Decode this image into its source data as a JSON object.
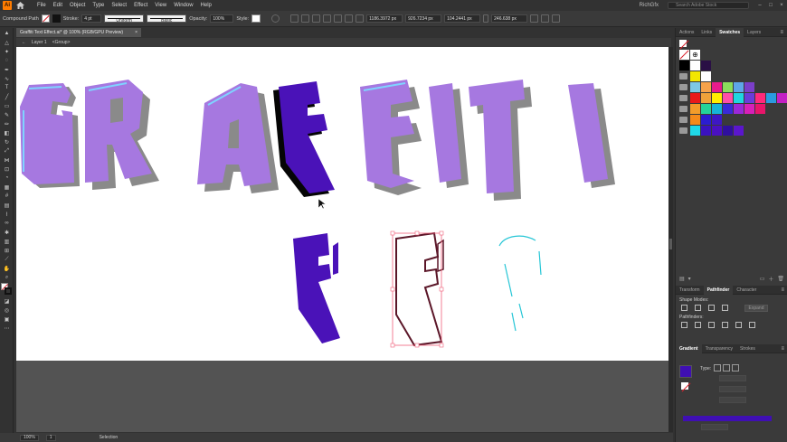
{
  "menubar": {
    "logo": "Ai",
    "items": [
      "File",
      "Edit",
      "Object",
      "Type",
      "Select",
      "Effect",
      "View",
      "Window",
      "Help"
    ],
    "user": "RichGfx",
    "search_placeholder": "Search Adobe Stock",
    "window_controls": [
      "–",
      "□",
      "×"
    ]
  },
  "controlbar": {
    "selection_type": "Compound Path",
    "stroke_label": "Stroke:",
    "stroke_weight": "4 pt",
    "profile": "Uniform",
    "brush": "Basic",
    "opacity_label": "Opacity:",
    "opacity_value": "100%",
    "style_label": "Style:",
    "x_value": "1186.3972 px",
    "y_value": "926.7234 px",
    "w_value": "104.2441 px",
    "h_value": "246.638 px"
  },
  "document": {
    "tab_title": "Graffiti Text Effect.ai* @ 100% (RGB/GPU Preview)",
    "close": "×",
    "breadcrumb": [
      "Layer 1",
      "<Group>"
    ]
  },
  "canvas": {
    "letters": [
      "G",
      "R",
      "A",
      "F",
      "F",
      "I",
      "T",
      "I"
    ],
    "colors": {
      "fill_purple": "#a678e0",
      "shadow_gray": "#8a8a8a",
      "highlight_blue": "#7fd3ff",
      "selected_fill": "#4a12b8",
      "outline_dark": "#5b1628",
      "selection_box": "#f0607a",
      "cyan_stroke": "#26c6d6"
    }
  },
  "statusbar": {
    "zoom": "100%",
    "artboard": "1",
    "tool": "Selection"
  },
  "panels": {
    "top_tabs": [
      "Actions",
      "Links",
      "Swatches",
      "Layers"
    ],
    "top_active": "Swatches",
    "swatch_rows": [
      [
        "#000000",
        "#ffffff",
        "#2a0f45"
      ],
      [
        "#f3e600",
        "#ffffff"
      ],
      [
        "#7ec8e3",
        "#f7a34a",
        "#e81c8c",
        "#8bdf5c",
        "#5ea6e8",
        "#7b3ec9"
      ],
      [
        "#e81a1a",
        "#f0a23a",
        "#ffee00",
        "#ff4fa8",
        "#1fd6e0",
        "#6a3cd9",
        "#ff2a7a",
        "#2b9be0",
        "#c41fc4"
      ],
      [
        "#f39c2a",
        "#24d39a",
        "#16b4d8",
        "#3a2ad8",
        "#9b28d8",
        "#d81fb8",
        "#e8156a"
      ],
      [
        "#f58a1a",
        "#2b1dd0",
        "#3e17c4"
      ],
      [
        "#20d9e8",
        "#3a12c0",
        "#4a10c2",
        "#2f0f9e",
        "#5b16cc"
      ]
    ],
    "mid_tabs": [
      "Transform",
      "Pathfinder",
      "Character"
    ],
    "mid_active": "Pathfinder",
    "shape_modes_label": "Shape Modes:",
    "pathfinders_label": "Pathfinders:",
    "expand_label": "Expand",
    "bottom_tabs": [
      "Gradient",
      "Transparency",
      "Strokes"
    ],
    "bottom_active": "Gradient",
    "gradient_type_label": "Type:",
    "gradient_color": "#3f0fb3"
  }
}
